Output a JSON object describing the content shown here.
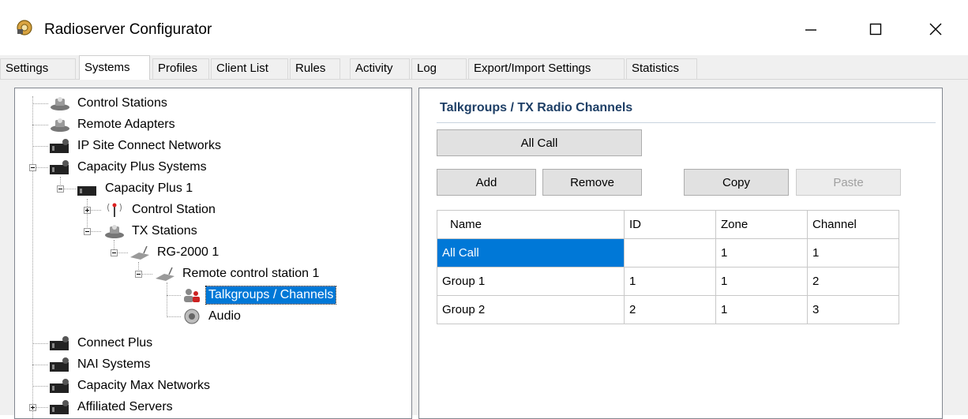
{
  "window": {
    "title": "Radioserver Configurator",
    "controls": {
      "minimize": "minimize-icon",
      "maximize": "maximize-icon",
      "close": "close-icon"
    }
  },
  "tabs": [
    {
      "label": "Settings",
      "active": false
    },
    {
      "label": "Systems",
      "active": true
    },
    {
      "label": "Profiles",
      "active": false
    },
    {
      "label": "Client List",
      "active": false
    },
    {
      "label": "Rules",
      "active": false
    },
    {
      "label": "Activity",
      "active": false
    },
    {
      "label": "Log",
      "active": false
    },
    {
      "label": "Export/Import Settings",
      "active": false
    },
    {
      "label": "Statistics",
      "active": false
    }
  ],
  "tree": {
    "nodes": [
      {
        "label": "Control Stations",
        "icon": "control-station-icon",
        "level": 0
      },
      {
        "label": "Remote Adapters",
        "icon": "remote-adapter-icon",
        "level": 0
      },
      {
        "label": "IP Site Connect Networks",
        "icon": "network-icon",
        "level": 0
      },
      {
        "label": "Capacity Plus Systems",
        "icon": "network-icon",
        "level": 0,
        "expanded": true
      },
      {
        "label": "Capacity Plus 1",
        "icon": "network-icon",
        "level": 1,
        "expanded": true
      },
      {
        "label": "Control Station",
        "icon": "antenna-icon",
        "level": 2,
        "expanded": false
      },
      {
        "label": "TX Stations",
        "icon": "control-station-icon",
        "level": 2,
        "expanded": true
      },
      {
        "label": "RG-2000 1",
        "icon": "gateway-icon",
        "level": 3,
        "expanded": true
      },
      {
        "label": "Remote control station 1",
        "icon": "gateway-icon",
        "level": 4,
        "expanded": true
      },
      {
        "label": "Talkgroups / Channels",
        "icon": "talkgroups-icon",
        "level": 5,
        "selected": true
      },
      {
        "label": "Audio",
        "icon": "speaker-icon",
        "level": 5
      },
      {
        "label": "Connect Plus",
        "icon": "network-icon",
        "level": 0
      },
      {
        "label": "NAI Systems",
        "icon": "network-icon",
        "level": 0
      },
      {
        "label": "Capacity Max Networks",
        "icon": "network-icon",
        "level": 0
      },
      {
        "label": "Affiliated Servers",
        "icon": "network-icon",
        "level": 0,
        "expanded": false
      }
    ]
  },
  "panel": {
    "title": "Talkgroups / TX Radio Channels",
    "all_call_button": "All Call",
    "add_button": "Add",
    "remove_button": "Remove",
    "copy_button": "Copy",
    "paste_button": "Paste"
  },
  "table": {
    "columns": [
      "Name",
      "ID",
      "Zone",
      "Channel"
    ],
    "rows": [
      [
        "All Call",
        "",
        "1",
        "1"
      ],
      [
        "Group 1",
        "1",
        "1",
        "2"
      ],
      [
        "Group 2",
        "2",
        "1",
        "3"
      ]
    ],
    "selected_row": 0
  },
  "colors": {
    "selection": "#0078d7",
    "section_title": "#1e3f66"
  }
}
